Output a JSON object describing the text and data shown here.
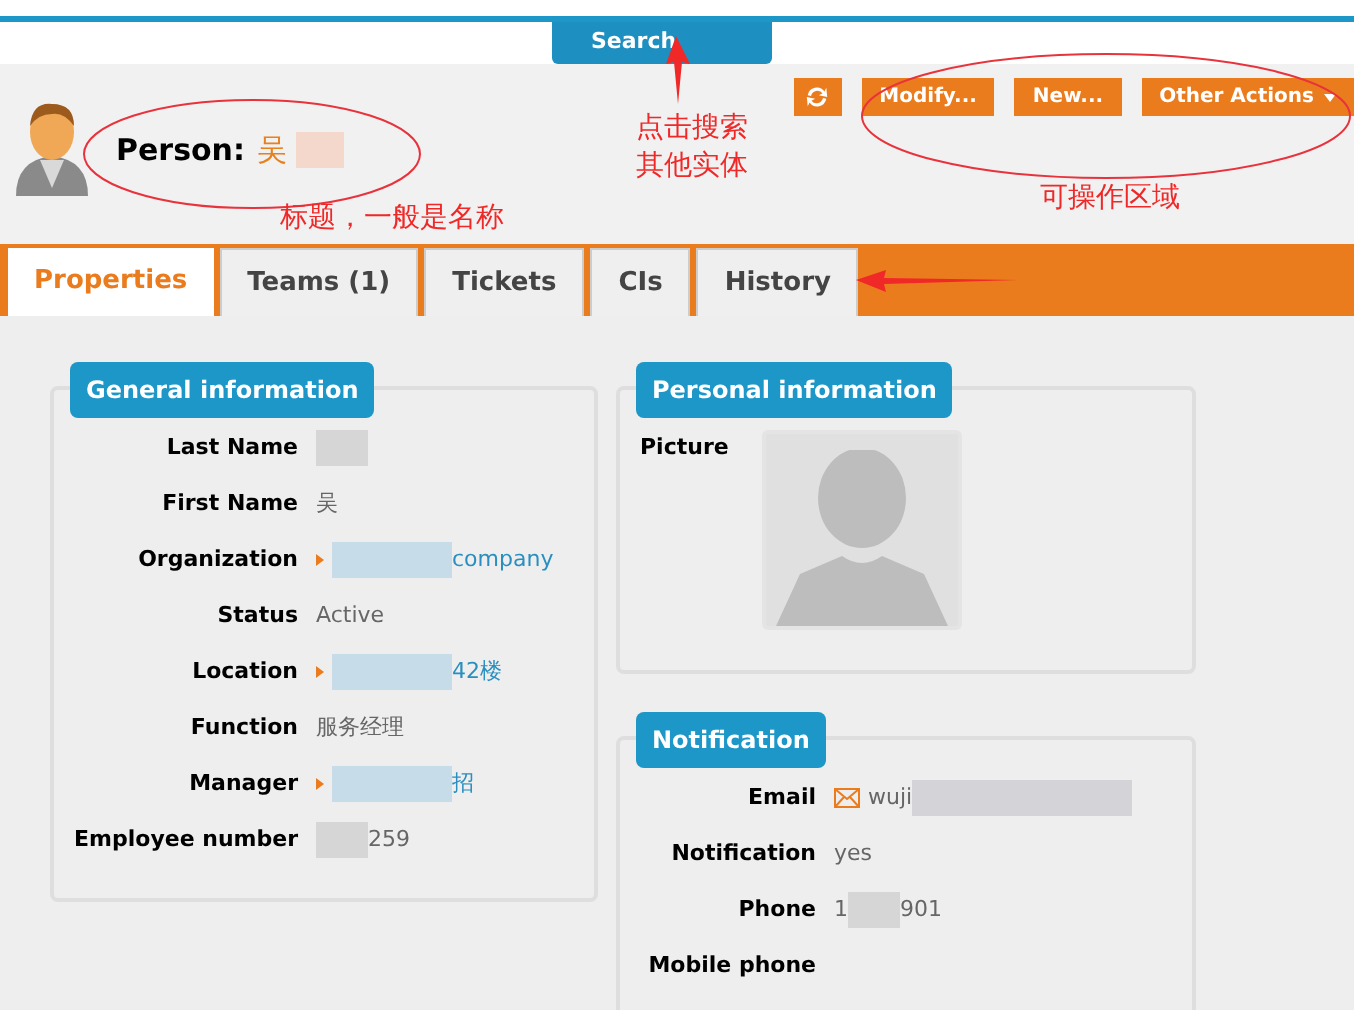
{
  "search_tab": {
    "label": "Search"
  },
  "header": {
    "title_label": "Person:",
    "title_parts": [
      {
        "kind": "text",
        "text": "吴 "
      },
      {
        "kind": "redaction"
      }
    ],
    "actions": [
      {
        "kind": "refresh"
      },
      {
        "kind": "button",
        "label": "Modify..."
      },
      {
        "kind": "button",
        "label": "New..."
      },
      {
        "kind": "menu",
        "label": "Other Actions"
      }
    ]
  },
  "tabs": [
    {
      "label": "Properties",
      "selected": true
    },
    {
      "label": "Teams (1)",
      "selected": false
    },
    {
      "label": "Tickets",
      "selected": false
    },
    {
      "label": "CIs",
      "selected": false
    },
    {
      "label": "History",
      "selected": false
    }
  ],
  "general": {
    "title": "General information",
    "fields": [
      {
        "label": "Last Name",
        "kind": "text",
        "parts": [
          {
            "kind": "redaction"
          }
        ]
      },
      {
        "label": "First Name",
        "kind": "text",
        "parts": [
          {
            "kind": "text",
            "text": "吴"
          }
        ]
      },
      {
        "label": "Organization",
        "kind": "link",
        "parts": [
          {
            "kind": "redaction"
          },
          {
            "kind": "text",
            "text": "company"
          }
        ]
      },
      {
        "label": "Status",
        "kind": "text",
        "parts": [
          {
            "kind": "text",
            "text": "Active"
          }
        ]
      },
      {
        "label": "Location",
        "kind": "link",
        "parts": [
          {
            "kind": "redaction"
          },
          {
            "kind": "text",
            "text": "42楼"
          }
        ]
      },
      {
        "label": "Function",
        "kind": "text",
        "parts": [
          {
            "kind": "text",
            "text": "服务经理"
          }
        ]
      },
      {
        "label": "Manager",
        "kind": "link",
        "parts": [
          {
            "kind": "redaction"
          },
          {
            "kind": "text",
            "text": "招"
          }
        ]
      },
      {
        "label": "Employee number",
        "kind": "text",
        "parts": [
          {
            "kind": "redaction"
          },
          {
            "kind": "text",
            "text": "259"
          }
        ]
      }
    ]
  },
  "personal": {
    "title": "Personal information",
    "fields": [
      {
        "label": "Picture",
        "kind": "picture"
      }
    ]
  },
  "notification": {
    "title": "Notification",
    "fields": [
      {
        "label": "Email",
        "kind": "email",
        "parts": [
          {
            "kind": "text",
            "text": "wuji"
          },
          {
            "kind": "redaction"
          }
        ]
      },
      {
        "label": "Notification",
        "kind": "text",
        "parts": [
          {
            "kind": "text",
            "text": "yes"
          }
        ]
      },
      {
        "label": "Phone",
        "kind": "text",
        "parts": [
          {
            "kind": "text",
            "text": "1"
          },
          {
            "kind": "redaction"
          },
          {
            "kind": "text",
            "text": "901"
          }
        ]
      },
      {
        "label": "Mobile phone",
        "kind": "text"
      }
    ]
  },
  "annotations": [
    {
      "text": "点击搜索"
    },
    {
      "text": "其他实体"
    },
    {
      "text": "标题，一般是名称"
    },
    {
      "text": "可操作区域"
    }
  ]
}
